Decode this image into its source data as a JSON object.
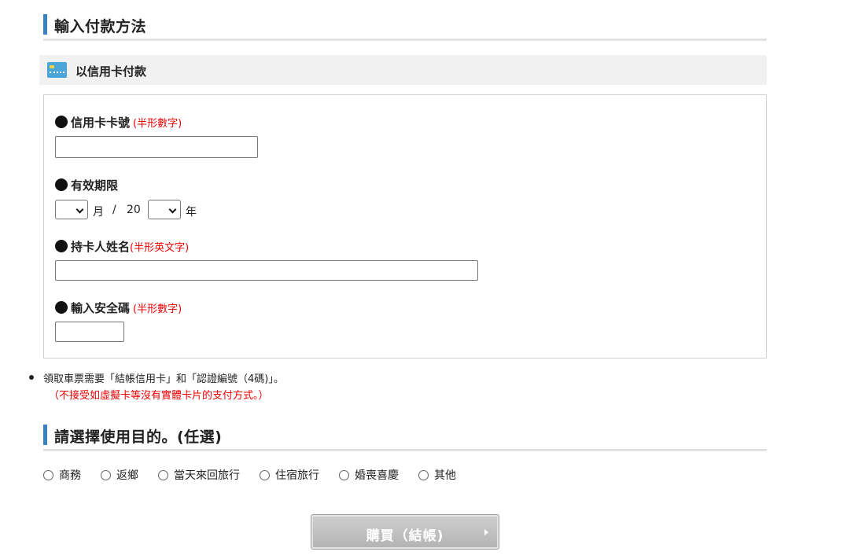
{
  "payment_section": {
    "title": "輸入付款方法",
    "credit_card_heading": "以信用卡付款",
    "card_number": {
      "label": "信用卡卡號",
      "note": "(半形數字)",
      "value": ""
    },
    "expiry": {
      "label": "有效期限",
      "month_value": "",
      "month_unit": "月",
      "separator": "/",
      "year_prefix": "20",
      "year_value": "",
      "year_unit": "年"
    },
    "holder_name": {
      "label": "持卡人姓名",
      "note": "(半形英文字)",
      "value": ""
    },
    "security_code": {
      "label": "輸入安全碼",
      "note": "(半形數字)",
      "value": ""
    }
  },
  "notes": {
    "line1": "領取車票需要「結帳信用卡」和「認證編號（4碼)」。",
    "line2": "（不接受如虛擬卡等沒有實體卡片的支付方式。）"
  },
  "purpose_section": {
    "title": "請選擇使用目的。(任選)",
    "options": [
      "商務",
      "返鄉",
      "當天來回旅行",
      "住宿旅行",
      "婚喪喜慶",
      "其他"
    ]
  },
  "buy_button": {
    "label": "購買（結帳)"
  },
  "colors": {
    "accent_bar": "#3b82c4",
    "note_red": "#e00000",
    "button_gray": "#c0c0c0"
  }
}
